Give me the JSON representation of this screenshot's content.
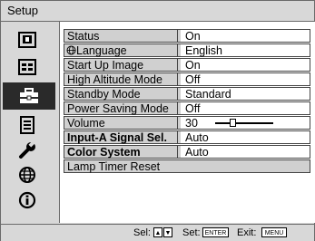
{
  "title": "Setup",
  "sidebar": {
    "items": [
      {
        "icon": "picture-icon"
      },
      {
        "icon": "screen-icon"
      },
      {
        "icon": "setup-toolbox-icon",
        "selected": true
      },
      {
        "icon": "menu-list-icon"
      },
      {
        "icon": "wrench-icon"
      },
      {
        "icon": "globe-icon"
      },
      {
        "icon": "info-icon"
      }
    ]
  },
  "settings": [
    {
      "label": "Status",
      "value": "On"
    },
    {
      "label": "Language",
      "value": "English"
    },
    {
      "label": "Start Up Image",
      "value": "On"
    },
    {
      "label": "High Altitude Mode",
      "value": "Off"
    },
    {
      "label": "Standby Mode",
      "value": "Standard"
    },
    {
      "label": "Power Saving Mode",
      "value": "Off"
    },
    {
      "label": "Volume",
      "value": "30",
      "level": 0.3
    },
    {
      "label": "Input-A Signal Sel.",
      "value": "Auto"
    },
    {
      "label": "Color System",
      "value": "Auto"
    },
    {
      "label": "Lamp Timer Reset",
      "value": ""
    }
  ],
  "footer": {
    "sel_label": "Sel:",
    "set_label": "Set:",
    "enter_key": "ENTER",
    "exit_label": "Exit:",
    "menu_key": "MENU"
  }
}
